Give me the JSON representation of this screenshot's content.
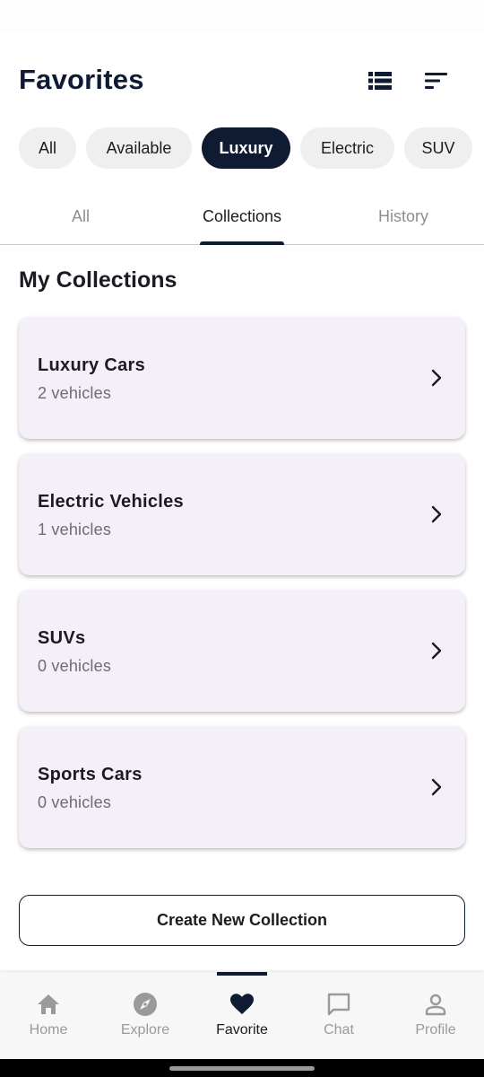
{
  "header": {
    "title": "Favorites",
    "list_view_icon": "list-view-icon",
    "sort_icon": "sort-icon"
  },
  "filter_chips": [
    "All",
    "Available",
    "Luxury",
    "Electric",
    "SUV"
  ],
  "selected_chip": "Luxury",
  "tabs": [
    "All",
    "Collections",
    "History"
  ],
  "selected_tab": "Collections",
  "section_title": "My Collections",
  "collections": [
    {
      "name": "Luxury Cars",
      "count": "2 vehicles"
    },
    {
      "name": "Electric Vehicles",
      "count": "1 vehicles"
    },
    {
      "name": "SUVs",
      "count": "0 vehicles"
    },
    {
      "name": "Sports Cars",
      "count": "0 vehicles"
    }
  ],
  "create_button": "Create New Collection",
  "bottom_nav": [
    {
      "label": "Home",
      "icon": "home-icon"
    },
    {
      "label": "Explore",
      "icon": "explore-icon"
    },
    {
      "label": "Favorite",
      "icon": "heart-icon"
    },
    {
      "label": "Chat",
      "icon": "chat-icon"
    },
    {
      "label": "Profile",
      "icon": "profile-icon"
    }
  ],
  "selected_nav": "Favorite",
  "colors": {
    "primary": "#0e1b33",
    "card_background": "#f4eff8",
    "chip_background": "#efefef",
    "inactive_text": "#9a9a9a"
  }
}
